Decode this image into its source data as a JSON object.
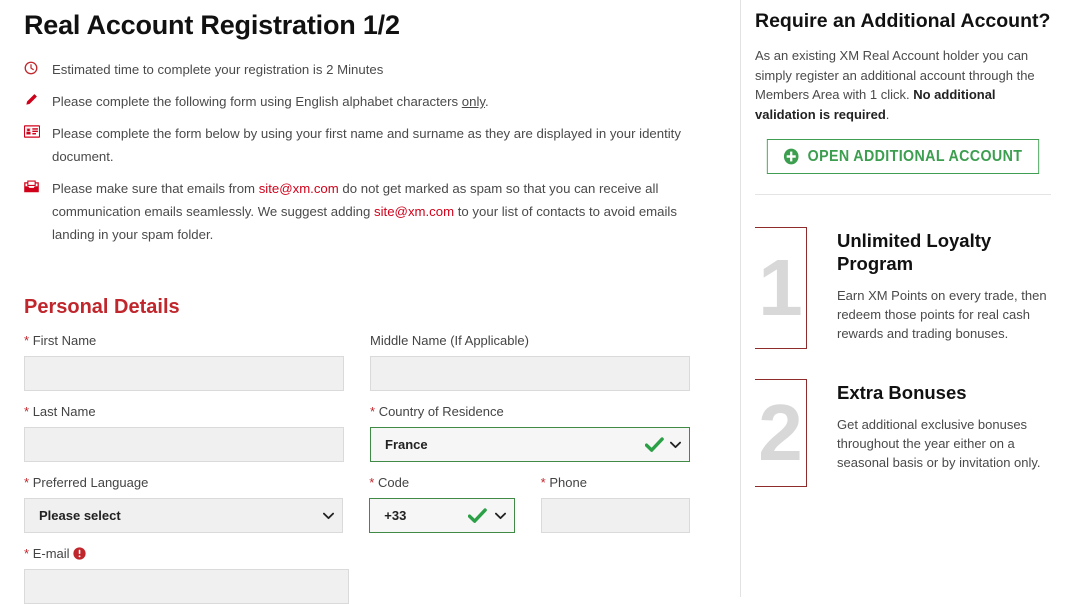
{
  "page_title": "Real Account Registration 1/2",
  "notices": [
    {
      "icon": "clock-icon",
      "parts": [
        {
          "t": "Estimated time to complete your registration is 2 Minutes",
          "style": "plain"
        }
      ]
    },
    {
      "icon": "pencil-icon",
      "parts": [
        {
          "t": "Please complete the following form using English alphabet characters ",
          "style": "plain"
        },
        {
          "t": "only",
          "style": "underline"
        },
        {
          "t": ".",
          "style": "plain"
        }
      ]
    },
    {
      "icon": "id-card-icon",
      "parts": [
        {
          "t": "Please complete the form below by using your first name and surname as they are displayed in your identity document.",
          "style": "plain"
        }
      ]
    },
    {
      "icon": "envelope-icon",
      "parts": [
        {
          "t": "Please make sure that emails from ",
          "style": "plain"
        },
        {
          "t": "site@xm.com",
          "style": "link"
        },
        {
          "t": " do not get marked as spam so that you can receive all communication emails seamlessly. We suggest adding ",
          "style": "plain"
        },
        {
          "t": "site@xm.com",
          "style": "link"
        },
        {
          "t": " to your list of contacts to avoid emails landing in your spam folder.",
          "style": "plain"
        }
      ]
    }
  ],
  "form": {
    "section_title": "Personal Details",
    "required_marker": "*",
    "first_name": {
      "label": "First Name",
      "required": true,
      "value": "",
      "placeholder": ""
    },
    "middle_name": {
      "label": "Middle Name (If Applicable)",
      "required": false,
      "value": "",
      "placeholder": ""
    },
    "last_name": {
      "label": "Last Name",
      "required": true,
      "value": "",
      "placeholder": ""
    },
    "country": {
      "label": "Country of Residence",
      "required": true,
      "value": "France",
      "valid": true
    },
    "language": {
      "label": "Preferred Language",
      "required": true,
      "value": "Please select",
      "valid": false
    },
    "code": {
      "label": "Code",
      "required": true,
      "value": "+33",
      "valid": true
    },
    "phone": {
      "label": "Phone",
      "required": true,
      "value": "",
      "placeholder": ""
    },
    "email": {
      "label": "E-mail",
      "required": true,
      "value": "",
      "placeholder": "",
      "info_icon": "info-circle-icon"
    }
  },
  "sidebar": {
    "title": "Require an Additional Account?",
    "paragraph_parts": [
      {
        "t": "As an existing XM Real Account holder you can simply register an additional account through the Members Area with 1 click. ",
        "style": "plain"
      },
      {
        "t": "No additional validation is required",
        "style": "bold"
      },
      {
        "t": ".",
        "style": "plain"
      }
    ],
    "open_button": {
      "label": "OPEN ADDITIONAL ACCOUNT",
      "icon": "plus-circle-icon"
    },
    "benefits": [
      {
        "number": "1",
        "title": "Unlimited Loyalty Program",
        "text": "Earn XM Points on every trade, then redeem those points for real cash rewards and trading bonuses."
      },
      {
        "number": "2",
        "title": "Extra Bonuses",
        "text": "Get additional exclusive bonuses throughout the year either on a seasonal basis or by invitation only."
      }
    ]
  },
  "colors": {
    "brand_red": "#c0272d",
    "link_red": "#d0021b",
    "valid_green": "#3f8a45",
    "button_green": "#3c9e4f",
    "box_border_red": "#8e2c2c",
    "field_bg": "#f0f0f0"
  }
}
